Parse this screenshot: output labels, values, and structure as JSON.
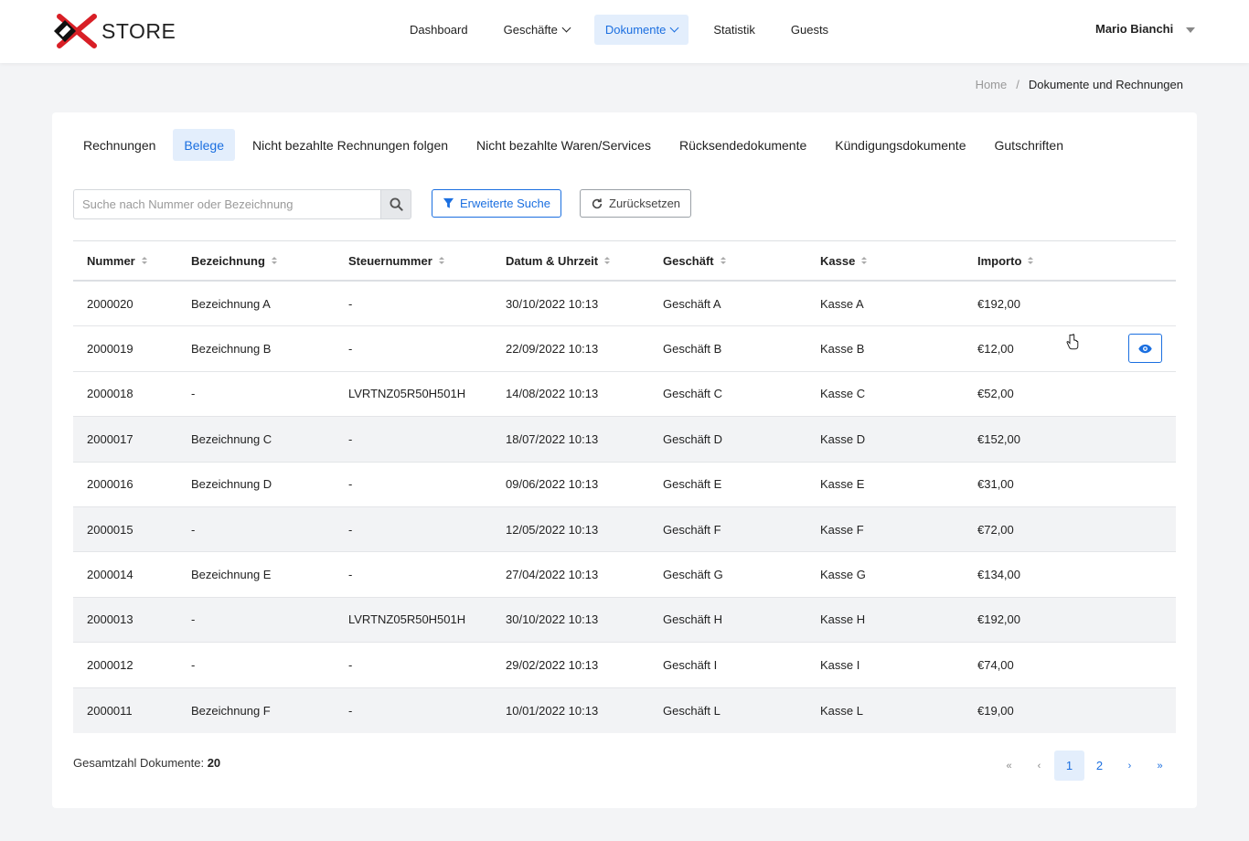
{
  "header": {
    "brand": "STORE",
    "nav": [
      {
        "label": "Dashboard",
        "dropdown": false,
        "active": false
      },
      {
        "label": "Geschäfte",
        "dropdown": true,
        "active": false
      },
      {
        "label": "Dokumente",
        "dropdown": true,
        "active": true
      },
      {
        "label": "Statistik",
        "dropdown": false,
        "active": false
      },
      {
        "label": "Guests",
        "dropdown": false,
        "active": false
      }
    ],
    "user": "Mario Bianchi"
  },
  "breadcrumb": {
    "home": "Home",
    "separator": "/",
    "current": "Dokumente und Rechnungen"
  },
  "tabs": [
    {
      "label": "Rechnungen",
      "active": false
    },
    {
      "label": "Belege",
      "active": true
    },
    {
      "label": "Nicht bezahlte Rechnungen folgen",
      "active": false
    },
    {
      "label": "Nicht bezahlte Waren/Services",
      "active": false
    },
    {
      "label": "Rücksendedokumente",
      "active": false
    },
    {
      "label": "Kündigungsdokumente",
      "active": false
    },
    {
      "label": "Gutschriften",
      "active": false
    }
  ],
  "search": {
    "placeholder": "Suche nach Nummer oder Bezeichnung",
    "value": ""
  },
  "buttons": {
    "advanced": "Erweiterte Suche",
    "reset": "Zurücksetzen"
  },
  "table": {
    "columns": [
      "Nummer",
      "Bezeichnung",
      "Steuernummer",
      "Datum & Uhrzeit",
      "Geschäft",
      "Kasse",
      "Importo"
    ],
    "rows": [
      [
        "2000020",
        "Bezeichnung A",
        "-",
        "30/10/2022 10:13",
        "Geschäft A",
        "Kasse A",
        "€192,00"
      ],
      [
        "2000019",
        "Bezeichnung B",
        "-",
        "22/09/2022 10:13",
        "Geschäft B",
        "Kasse B",
        "€12,00"
      ],
      [
        "2000018",
        "-",
        "LVRTNZ05R50H501H",
        "14/08/2022 10:13",
        "Geschäft C",
        "Kasse C",
        "€52,00"
      ],
      [
        "2000017",
        "Bezeichnung C",
        "-",
        "18/07/2022 10:13",
        "Geschäft D",
        "Kasse D",
        "€152,00"
      ],
      [
        "2000016",
        "Bezeichnung D",
        "-",
        "09/06/2022 10:13",
        "Geschäft E",
        "Kasse E",
        "€31,00"
      ],
      [
        "2000015",
        "-",
        "-",
        "12/05/2022 10:13",
        "Geschäft F",
        "Kasse F",
        "€72,00"
      ],
      [
        "2000014",
        "Bezeichnung E",
        "-",
        "27/04/2022 10:13",
        "Geschäft G",
        "Kasse G",
        "€134,00"
      ],
      [
        "2000013",
        "-",
        "LVRTNZ05R50H501H",
        "30/10/2022 10:13",
        "Geschäft H",
        "Kasse H",
        "€192,00"
      ],
      [
        "2000012",
        "-",
        "-",
        "29/02/2022 10:13",
        "Geschäft I",
        "Kasse I",
        "€74,00"
      ],
      [
        "2000011",
        "Bezeichnung F",
        "-",
        "10/01/2022 10:13",
        "Geschäft L",
        "Kasse L",
        "€19,00"
      ]
    ],
    "alt_rows": [
      3,
      5,
      7,
      9
    ],
    "hover_row": 1
  },
  "footer": {
    "total_label": "Gesamtzahl Dokumente:",
    "total_value": "20",
    "pagination": {
      "first": "«",
      "prev": "‹",
      "pages": [
        "1",
        "2"
      ],
      "current": "1",
      "next": "›",
      "last": "»"
    }
  },
  "colors": {
    "accent": "#1b6fe0",
    "active_bg": "#e3eefc",
    "page_bg": "#f3f4f6"
  },
  "icons": {
    "search": "search-icon",
    "filter": "filter-icon",
    "reset": "refresh-icon",
    "view": "eye-icon",
    "cursor": "hand-cursor-icon"
  }
}
